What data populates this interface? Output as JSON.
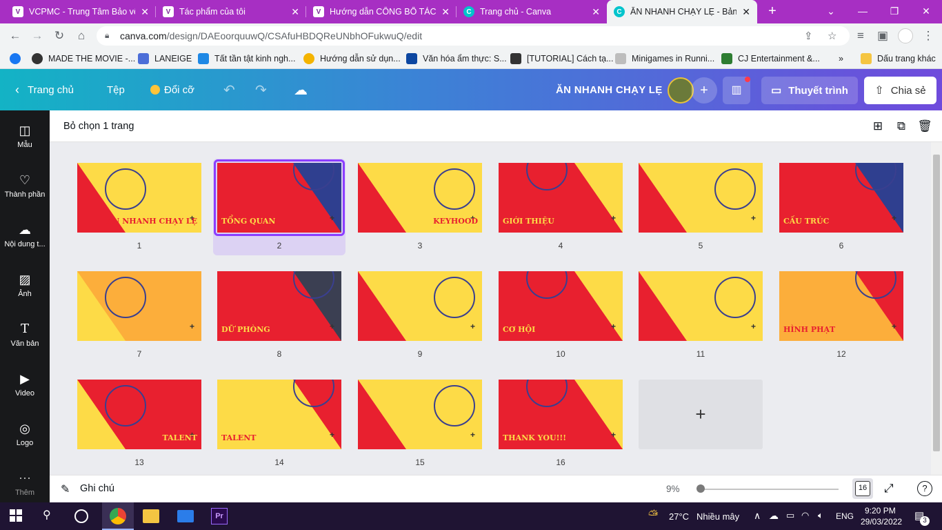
{
  "browser": {
    "tabs": [
      {
        "title": "VCPMC - Trung Tâm Bảo vệ Q"
      },
      {
        "title": "Tác phẩm của tôi"
      },
      {
        "title": "Hướng dẫn CÔNG BỐ TÁC PH"
      },
      {
        "title": "Trang chủ - Canva"
      },
      {
        "title": "ĂN NHANH CHẠY LẸ - Bản th"
      }
    ],
    "url_host": "canva.com",
    "url_path": "/design/DAEoorquuwQ/CSAfuHBDQReUNbhOFukwuQ/edit",
    "bookmarks": [
      {
        "label": "MADE THE MOVIE -...",
        "color": "#1877f2"
      },
      {
        "label": "LANEIGE",
        "color": "#4c6ed8"
      },
      {
        "label": "Tất tần tật kinh ngh...",
        "color": "#1e88e5"
      },
      {
        "label": "Hướng dẫn sử dụn...",
        "color": "#f4b400"
      },
      {
        "label": "Văn hóa ẩm thực: S...",
        "color": "#0d47a1"
      },
      {
        "label": "[TUTORIAL] Cách tạ...",
        "color": "#333333"
      },
      {
        "label": "Minigames in Runni...",
        "color": "#bdbdbd"
      },
      {
        "label": "CJ Entertainment &...",
        "color": "#2e7d32"
      }
    ],
    "other_bookmarks": "Dấu trang khác"
  },
  "header": {
    "home": "Trang chủ",
    "file": "Tệp",
    "resize": "Đổi cỡ",
    "title": "ĂN NHANH CHẠY LẸ",
    "present": "Thuyết trình",
    "share": "Chia sẻ"
  },
  "sidebar": [
    {
      "label": "Mẫu",
      "icon": "template-icon"
    },
    {
      "label": "Thành phần",
      "icon": "elements-icon"
    },
    {
      "label": "Nội dung t...",
      "icon": "upload-icon"
    },
    {
      "label": "Ảnh",
      "icon": "photo-icon"
    },
    {
      "label": "Văn bản",
      "icon": "text-icon"
    },
    {
      "label": "Video",
      "icon": "video-icon"
    },
    {
      "label": "Logo",
      "icon": "logo-icon"
    },
    {
      "label": "Thêm",
      "icon": "more-icon"
    }
  ],
  "grid": {
    "deselect_label": "Bỏ chọn 1 trang",
    "slides": [
      {
        "num": "1",
        "bg": "#fddb47",
        "accent": "#e8202f",
        "text": "ĂN NHANH CHẠY LẸ"
      },
      {
        "num": "2",
        "bg": "#e8202f",
        "accent": "#2f3f8f",
        "text": "TỔNG QUAN"
      },
      {
        "num": "3",
        "bg": "#fddb47",
        "accent": "#e8202f",
        "text": "KEYHOOD"
      },
      {
        "num": "4",
        "bg": "#e8202f",
        "accent": "#fddb47",
        "text": "GIỚI THIỆU"
      },
      {
        "num": "5",
        "bg": "#fddb47",
        "accent": "#e8202f",
        "text": ""
      },
      {
        "num": "6",
        "bg": "#e8202f",
        "accent": "#2f3f8f",
        "text": "CẤU TRÚC"
      },
      {
        "num": "7",
        "bg": "#fcae3b",
        "accent": "#fddb47",
        "text": ""
      },
      {
        "num": "8",
        "bg": "#e8202f",
        "accent": "#3b3f52",
        "text": "DỮ PHÒNG"
      },
      {
        "num": "9",
        "bg": "#fddb47",
        "accent": "#e8202f",
        "text": ""
      },
      {
        "num": "10",
        "bg": "#e8202f",
        "accent": "#fddb47",
        "text": "CƠ HỘI"
      },
      {
        "num": "11",
        "bg": "#fddb47",
        "accent": "#e8202f",
        "text": ""
      },
      {
        "num": "12",
        "bg": "#fcae3b",
        "accent": "#e8202f",
        "text": "HÌNH PHẠT"
      },
      {
        "num": "13",
        "bg": "#e8202f",
        "accent": "#fddb47",
        "text": "TALENT"
      },
      {
        "num": "14",
        "bg": "#fddb47",
        "accent": "#e8202f",
        "text": "TALENT"
      },
      {
        "num": "15",
        "bg": "#fddb47",
        "accent": "#e8202f",
        "text": ""
      },
      {
        "num": "16",
        "bg": "#e8202f",
        "accent": "#fddb47",
        "text": "THANK YOU!!!"
      }
    ],
    "add_slide": "+"
  },
  "bottombar": {
    "notes": "Ghi chú",
    "zoom": "9%",
    "page_count": "16"
  },
  "taskbar": {
    "weather": "27°C",
    "weather_desc": "Nhiều mây",
    "lang": "ENG",
    "time": "9:20 PM",
    "date": "29/03/2022",
    "notif_count": "3"
  }
}
